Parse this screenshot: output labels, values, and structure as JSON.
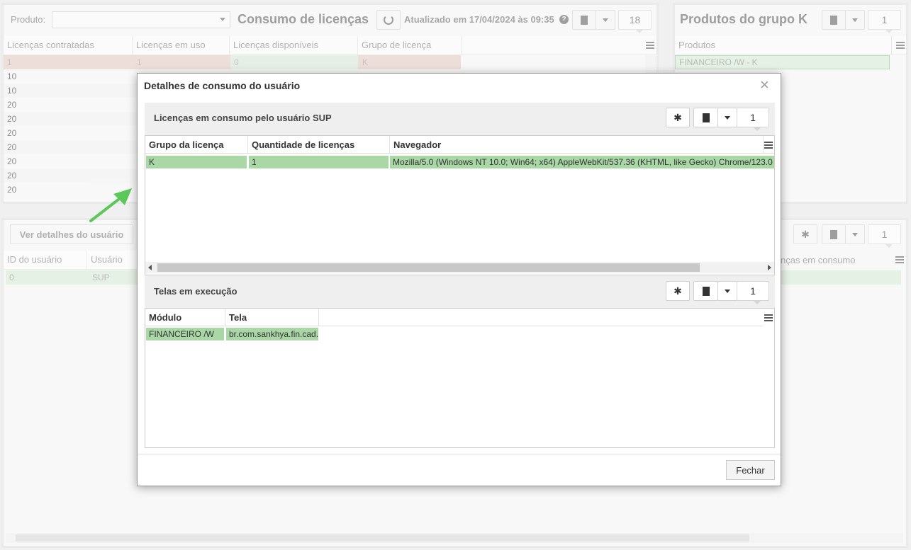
{
  "consumo": {
    "produto_label": "Produto:",
    "title": "Consumo de licenças",
    "updated": "Atualizado em 17/04/2024 às 09:35",
    "count": "18",
    "columns": [
      "Licenças contratadas",
      "Licenças em uso",
      "Licenças disponíveis",
      "Grupo de licença"
    ],
    "first_row": [
      "1",
      "1",
      "0",
      "K"
    ],
    "col1_values": [
      "10",
      "10",
      "20",
      "20",
      "20",
      "20",
      "20",
      "20",
      "20"
    ]
  },
  "produtos_grupo": {
    "title": "Produtos do grupo K",
    "count": "1",
    "column": "Produtos",
    "row": "FINANCEIRO /W - K"
  },
  "usuarios": {
    "button": "Ver detalhes do usuário",
    "count": "1",
    "columns": [
      "ID do usuário",
      "Usuário"
    ],
    "right_column": "nças em consumo",
    "row": [
      "0",
      "SUP"
    ]
  },
  "modal": {
    "title": "Detalhes de consumo do usuário",
    "section1": {
      "title": "Licenças em consumo pelo usuário SUP",
      "count": "1",
      "columns": [
        "Grupo da licença",
        "Quantidade de licenças",
        "Navegador"
      ],
      "row": [
        "K",
        "1",
        "Mozilla/5.0 (Windows NT 10.0; Win64; x64) AppleWebKit/537.36 (KHTML, like Gecko) Chrome/123.0"
      ]
    },
    "section2": {
      "title": "Telas em execução",
      "count": "1",
      "columns": [
        "Módulo",
        "Tela"
      ],
      "row": [
        "FINANCEIRO /W",
        "br.com.sankhya.fin.cad."
      ]
    },
    "close_button": "Fechar"
  },
  "colors": {
    "accent_green": "#a9d8a6",
    "row_highlight": "#e6c9c0",
    "arrow": "#5cc85a"
  }
}
